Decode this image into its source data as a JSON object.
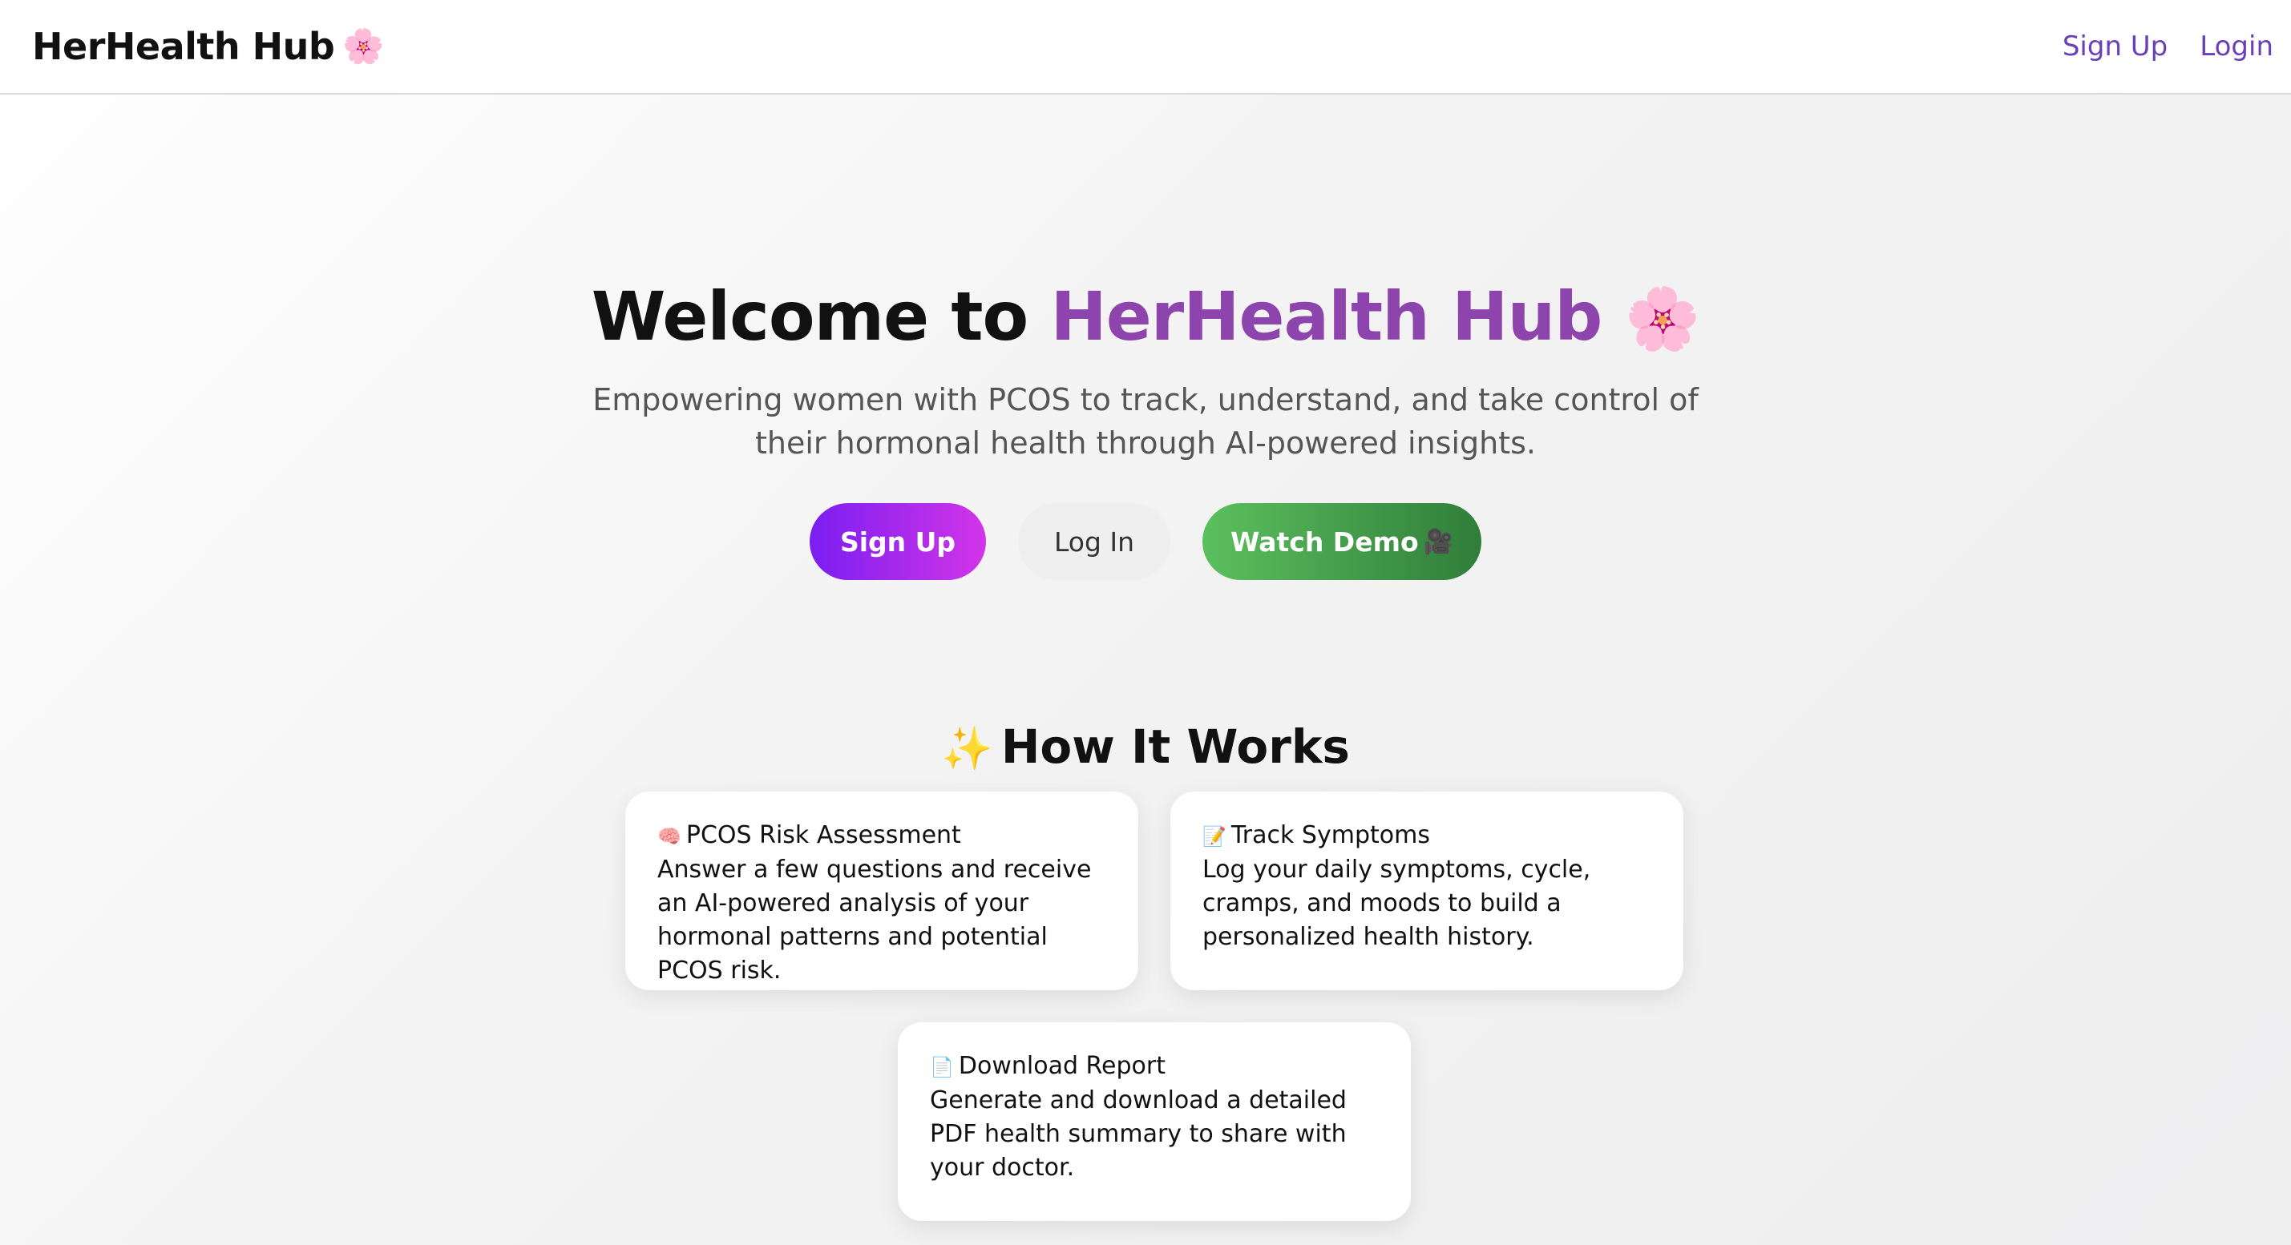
{
  "navbar": {
    "brand": "HerHealth Hub",
    "brand_emoji": "🌸",
    "links": [
      "Sign Up",
      "Login"
    ]
  },
  "hero": {
    "title_prefix": "Welcome to",
    "title_accent": "HerHealth Hub",
    "title_emoji": "🌸",
    "subtitle": "Empowering women with PCOS to track, understand, and take control of their hormonal health through AI-powered insights.",
    "buttons": {
      "signup": "Sign Up",
      "login": "Log In",
      "demo": "Watch Demo",
      "demo_emoji": "🎥"
    }
  },
  "how_it_works": {
    "title": "How It Works",
    "title_emoji": "✨",
    "cards": [
      {
        "icon": "🧠",
        "icon_name": "brain-icon",
        "title": "PCOS Risk Assessment",
        "text": "Answer a few questions and receive an AI-powered analysis of your hormonal patterns and potential PCOS risk."
      },
      {
        "icon": "📝",
        "icon_name": "memo-icon",
        "title": "Track Symptoms",
        "text": "Log your daily symptoms, cycle, cramps, and moods to build a personalized health history."
      },
      {
        "icon": "📄",
        "icon_name": "document-icon",
        "title": "Download Report",
        "text": "Generate and download a detailed PDF health summary to share with your doctor."
      }
    ]
  },
  "colors": {
    "accent_purple": "#8e44ad",
    "nav_link": "#6a3fb8",
    "signup_gradient_start": "#7a1ef0",
    "signup_gradient_end": "#d235e8",
    "demo_gradient_start": "#5cc05e",
    "demo_gradient_end": "#2f7d3a"
  }
}
